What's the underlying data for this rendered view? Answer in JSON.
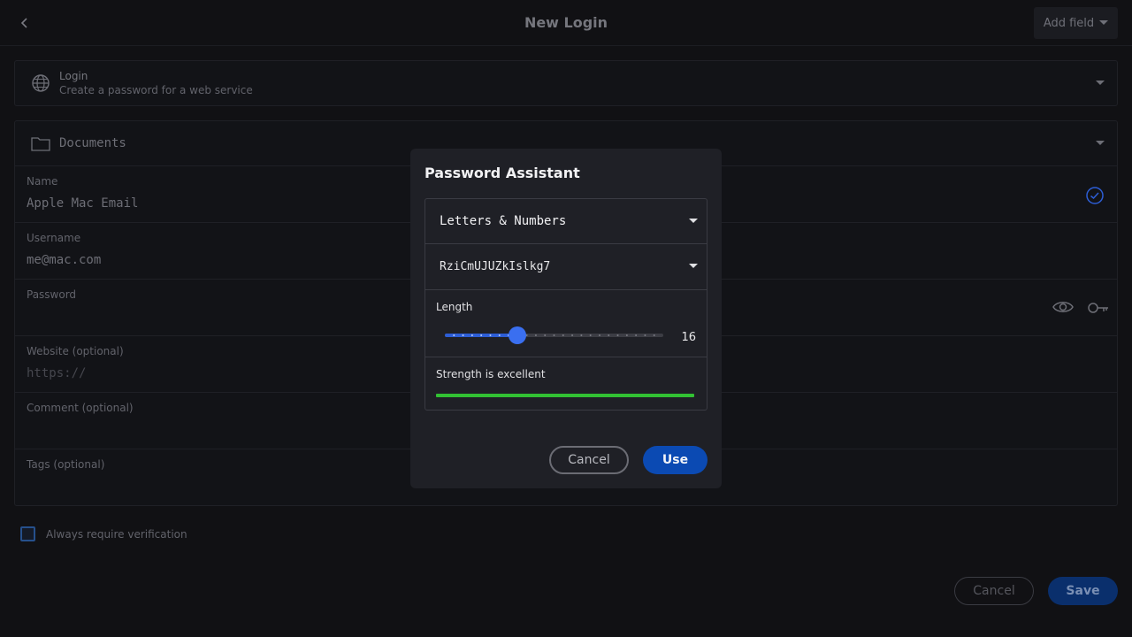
{
  "header": {
    "title": "New Login",
    "add_field_label": "Add field"
  },
  "login_card": {
    "title": "Login",
    "subtitle": "Create a password for a web service"
  },
  "form": {
    "folder": "Documents",
    "fields": [
      {
        "label": "Name",
        "value": "Apple Mac Email",
        "placeholder": ""
      },
      {
        "label": "Username",
        "value": "me@mac.com",
        "placeholder": ""
      },
      {
        "label": "Password",
        "value": "",
        "placeholder": ""
      },
      {
        "label": "Website (optional)",
        "value": "",
        "placeholder": "https://"
      },
      {
        "label": "Comment (optional)",
        "value": "",
        "placeholder": ""
      },
      {
        "label": "Tags (optional)",
        "value": "",
        "placeholder": ""
      }
    ],
    "verification_label": "Always require verification",
    "verification_checked": false,
    "cancel_label": "Cancel",
    "save_label": "Save"
  },
  "dialog": {
    "title": "Password Assistant",
    "type_selected": "Letters & Numbers",
    "generated_password": "RziCmUJUZkIslkg7",
    "length_label": "Length",
    "length_value": 16,
    "length_min": 8,
    "length_max": 32,
    "strength_label": "Strength is excellent",
    "strength_fraction": 1.0,
    "cancel_label": "Cancel",
    "use_label": "Use"
  },
  "colors": {
    "accent": "#3a6ff0",
    "primary_button": "#0b4ab3",
    "strength_good": "#32c133"
  }
}
